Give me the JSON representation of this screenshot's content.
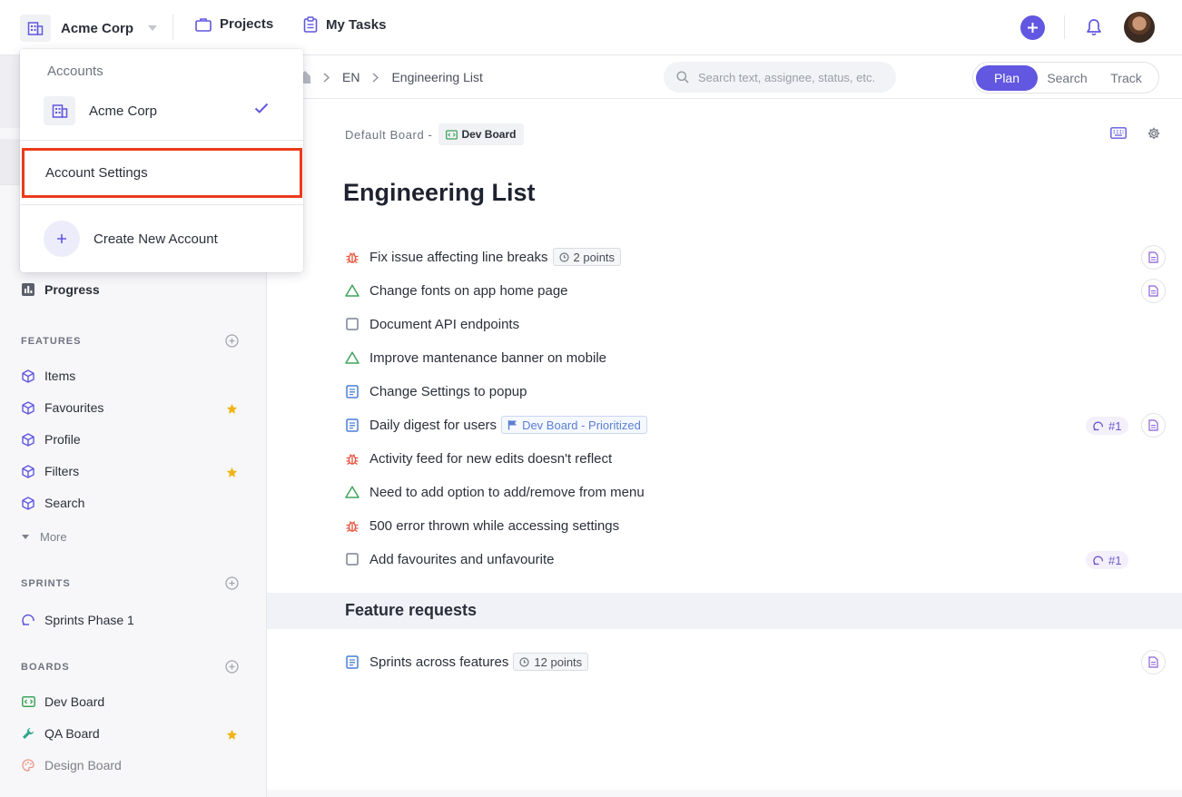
{
  "topbar": {
    "account_name": "Acme Corp",
    "nav": [
      {
        "label": "Projects",
        "icon": "briefcase-icon"
      },
      {
        "label": "My Tasks",
        "icon": "clipboard-icon"
      }
    ]
  },
  "account_menu": {
    "heading": "Accounts",
    "accounts": [
      {
        "name": "Acme Corp",
        "selected": true
      }
    ],
    "settings_label": "Account Settings",
    "create_label": "Create New Account"
  },
  "sidebar": {
    "progress_label": "Progress",
    "features": {
      "heading": "FEATURES",
      "items": [
        {
          "label": "Items",
          "starred": false
        },
        {
          "label": "Favourites",
          "starred": true
        },
        {
          "label": "Profile",
          "starred": false
        },
        {
          "label": "Filters",
          "starred": true
        },
        {
          "label": "Search",
          "starred": false
        }
      ],
      "more_label": "More"
    },
    "sprints": {
      "heading": "SPRINTS",
      "items": [
        {
          "label": "Sprints Phase 1"
        }
      ]
    },
    "boards": {
      "heading": "BOARDS",
      "items": [
        {
          "label": "Dev Board",
          "starred": false,
          "icon": "code-board-icon"
        },
        {
          "label": "QA Board",
          "starred": true,
          "icon": "wrench-icon"
        },
        {
          "label": "Design Board",
          "starred": false,
          "icon": "palette-icon"
        }
      ]
    }
  },
  "breadcrumb": [
    "EN",
    "Engineering List"
  ],
  "search": {
    "placeholder": "Search text, assignee, status, etc."
  },
  "mode_tabs": {
    "items": [
      "Plan",
      "Search",
      "Track"
    ],
    "active": "Plan"
  },
  "board": {
    "prefix": "Default Board -",
    "name": "Dev Board"
  },
  "page_title": "Engineering List",
  "tasks": [
    {
      "type": "bug",
      "title": "Fix issue affecting line breaks",
      "tag": "2 points",
      "has_doc": true
    },
    {
      "type": "improvement",
      "title": "Change fonts on app home page",
      "has_doc": true
    },
    {
      "type": "task",
      "title": "Document API endpoints"
    },
    {
      "type": "improvement",
      "title": "Improve mantenance banner on mobile"
    },
    {
      "type": "story",
      "title": "Change Settings to popup"
    },
    {
      "type": "story",
      "title": "Daily digest for users",
      "board_tag": "Dev Board - Prioritized",
      "sprint": "#1",
      "has_doc": true
    },
    {
      "type": "bug",
      "title": "Activity feed for new edits doesn't reflect"
    },
    {
      "type": "improvement",
      "title": "Need to add option to add/remove from menu"
    },
    {
      "type": "bug",
      "title": "500 error thrown while accessing settings"
    },
    {
      "type": "task",
      "title": "Add favourites and unfavourite",
      "sprint": "#1"
    }
  ],
  "section": {
    "title": "Feature requests",
    "tasks": [
      {
        "type": "story",
        "title": "Sprints across features",
        "tag": "12 points",
        "has_doc": true
      }
    ]
  },
  "colors": {
    "accent": "#6157e0",
    "bug": "#e5533d",
    "improvement": "#3fa35a",
    "story": "#4a7fd8",
    "task": "#7d8191",
    "highlight": "#ec3a1c",
    "star": "#f2b211"
  }
}
